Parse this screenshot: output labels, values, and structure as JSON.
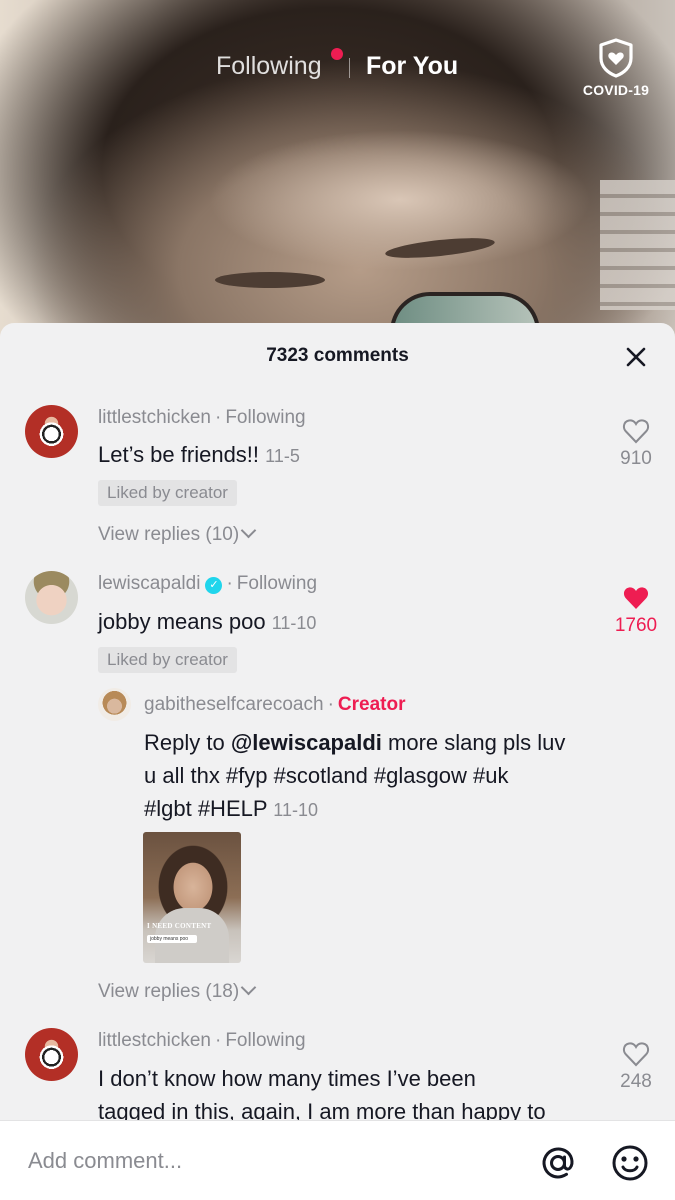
{
  "nav": {
    "following_label": "Following",
    "for_you_label": "For You",
    "covid_label": "COVID-19",
    "covid_icon": "shield-heart-icon",
    "accent_color": "#ee1d52"
  },
  "comments_panel": {
    "title": "7323 comments",
    "close_icon": "close-icon",
    "comments": [
      {
        "username": "littlestchicken",
        "relation": "Following",
        "text": "Let’s be friends!!",
        "date": "11-5",
        "liked_by_creator": "Liked by creator",
        "like_count": "910",
        "liked": false,
        "view_replies": "View replies (10)"
      },
      {
        "username": "lewiscapaldi",
        "verified": true,
        "relation": "Following",
        "text": "jobby means poo",
        "date": "11-10",
        "liked_by_creator": "Liked by creator",
        "like_count": "1760",
        "liked": true,
        "reply": {
          "username": "gabitheselfcarecoach",
          "tag": "Creator",
          "prefix": "Reply to ",
          "mention": "@lewiscapaldi",
          "text_line1_rest": " more slang pls luv",
          "text_line2": "u all thx #fyp #scotland #glasgow #uk",
          "text_line3": "#lgbt #HELP",
          "date": "11-10",
          "video_caption": "I NEED CONTENT",
          "video_pill": "jobby means poo"
        },
        "view_replies": "View replies (18)"
      },
      {
        "username": "littlestchicken",
        "relation": "Following",
        "text_line1": "I don’t know how many times I’ve been",
        "text_line2": "tagged in this, again, I am more than happy to",
        "like_count": "248",
        "liked": false
      }
    ]
  },
  "input": {
    "placeholder": "Add comment...",
    "mention_icon": "at-sign-icon",
    "emoji_icon": "emoji-icon"
  }
}
